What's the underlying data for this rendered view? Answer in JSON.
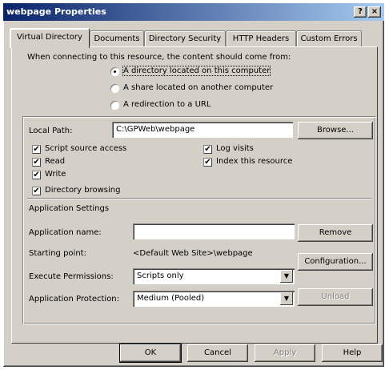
{
  "window": {
    "title": "webpage Properties",
    "help_glyph": "?",
    "close_glyph": "×"
  },
  "tabs": [
    {
      "label": "Virtual Directory",
      "active": true
    },
    {
      "label": "Documents"
    },
    {
      "label": "Directory Security"
    },
    {
      "label": "HTTP Headers"
    },
    {
      "label": "Custom Errors"
    }
  ],
  "source": {
    "prompt": "When connecting to this resource, the content should come from:",
    "options": [
      {
        "label": "A directory located on this computer",
        "checked": true
      },
      {
        "label": "A share located on another computer",
        "checked": false
      },
      {
        "label": "A redirection to a URL",
        "checked": false
      }
    ]
  },
  "local_path": {
    "label": "Local Path:",
    "value": "C:\\GPWeb\\webpage",
    "browse_label": "Browse..."
  },
  "permissions": {
    "script_source_access": {
      "label": "Script source access",
      "checked": true
    },
    "read": {
      "label": "Read",
      "checked": true
    },
    "write": {
      "label": "Write",
      "checked": true
    },
    "directory_browsing": {
      "label": "Directory browsing",
      "checked": true
    },
    "log_visits": {
      "label": "Log visits",
      "checked": true
    },
    "index_resource": {
      "label": "Index this resource",
      "checked": true
    }
  },
  "app_settings": {
    "heading": "Application Settings",
    "name_label": "Application name:",
    "name_value": "",
    "remove_label": "Remove",
    "starting_point_label": "Starting point:",
    "starting_point_value": "<Default Web Site>\\webpage",
    "configuration_label": "Configuration...",
    "exec_perm_label": "Execute Permissions:",
    "exec_perm_value": "Scripts only",
    "protection_label": "Application Protection:",
    "protection_value": "Medium (Pooled)",
    "unload_label": "Unload",
    "unload_enabled": false
  },
  "footer": {
    "ok": "OK",
    "cancel": "Cancel",
    "apply": "Apply",
    "apply_enabled": false,
    "help": "Help"
  },
  "check_glyph": "✔"
}
